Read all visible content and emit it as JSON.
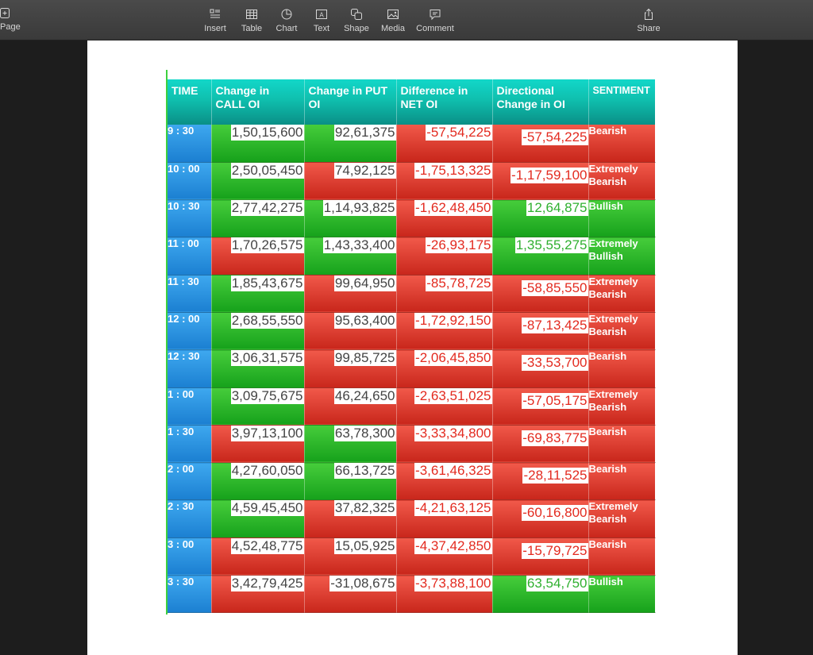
{
  "toolbar": {
    "page_label": "Page",
    "items": [
      {
        "label": "Insert",
        "icon": "insert-icon"
      },
      {
        "label": "Table",
        "icon": "table-icon"
      },
      {
        "label": "Chart",
        "icon": "chart-icon"
      },
      {
        "label": "Text",
        "icon": "text-icon"
      },
      {
        "label": "Shape",
        "icon": "shape-icon"
      },
      {
        "label": "Media",
        "icon": "media-icon"
      },
      {
        "label": "Comment",
        "icon": "comment-icon"
      }
    ],
    "share_label": "Share"
  },
  "table": {
    "headers": [
      "TIME",
      "Change in CALL OI",
      "Change in PUT OI",
      "Difference in NET OI",
      "Directional Change in OI",
      "SENTIMENT"
    ],
    "rows": [
      {
        "time": "9 : 30",
        "call": "1,50,15,600",
        "put": "92,61,375",
        "diff": "-57,54,225",
        "dir": "-57,54,225",
        "sentiment": "Bearish"
      },
      {
        "time": "10 : 00",
        "call": "2,50,05,450",
        "put": "74,92,125",
        "diff": "-1,75,13,325",
        "dir": "-1,17,59,100",
        "sentiment": "Extremely Bearish"
      },
      {
        "time": "10 : 30",
        "call": "2,77,42,275",
        "put": "1,14,93,825",
        "diff": "-1,62,48,450",
        "dir": "12,64,875",
        "sentiment": "Bullish"
      },
      {
        "time": "11 : 00",
        "call": "1,70,26,575",
        "put": "1,43,33,400",
        "diff": "-26,93,175",
        "dir": "1,35,55,275",
        "sentiment": "Extremely Bullish"
      },
      {
        "time": "11 : 30",
        "call": "1,85,43,675",
        "put": "99,64,950",
        "diff": "-85,78,725",
        "dir": "-58,85,550",
        "sentiment": "Extremely Bearish"
      },
      {
        "time": "12 : 00",
        "call": "2,68,55,550",
        "put": "95,63,400",
        "diff": "-1,72,92,150",
        "dir": "-87,13,425",
        "sentiment": "Extremely Bearish"
      },
      {
        "time": "12 : 30",
        "call": "3,06,31,575",
        "put": "99,85,725",
        "diff": "-2,06,45,850",
        "dir": "-33,53,700",
        "sentiment": "Bearish"
      },
      {
        "time": "1 : 00",
        "call": "3,09,75,675",
        "put": "46,24,650",
        "diff": "-2,63,51,025",
        "dir": "-57,05,175",
        "sentiment": "Extremely Bearish"
      },
      {
        "time": "1 : 30",
        "call": "3,97,13,100",
        "put": "63,78,300",
        "diff": "-3,33,34,800",
        "dir": "-69,83,775",
        "sentiment": "Bearish"
      },
      {
        "time": "2 : 00",
        "call": "4,27,60,050",
        "put": "66,13,725",
        "diff": "-3,61,46,325",
        "dir": "-28,11,525",
        "sentiment": "Bearish"
      },
      {
        "time": "2 : 30",
        "call": "4,59,45,450",
        "put": "37,82,325",
        "diff": "-4,21,63,125",
        "dir": "-60,16,800",
        "sentiment": "Extremely Bearish"
      },
      {
        "time": "3 : 00",
        "call": "4,52,48,775",
        "put": "15,05,925",
        "diff": "-4,37,42,850",
        "dir": "-15,79,725",
        "sentiment": "Bearish"
      },
      {
        "time": "3 : 30",
        "call": "3,42,79,425",
        "put": "-31,08,675",
        "diff": "-3,73,88,100",
        "dir": "63,54,750",
        "sentiment": "Bullish"
      }
    ]
  },
  "colors": {
    "header_teal": "#0fbfae",
    "time_blue": "#1b7fd1",
    "cell_green": "#16a11b",
    "cell_red": "#c8261b",
    "value_red": "#e32a1f",
    "value_green": "#2fb02f"
  },
  "cell_colors": [
    [
      "g",
      "g",
      "r",
      "r",
      "r"
    ],
    [
      "g",
      "r",
      "r",
      "r",
      "r"
    ],
    [
      "g",
      "g",
      "r",
      "g",
      "g"
    ],
    [
      "r",
      "g",
      "r",
      "g",
      "g"
    ],
    [
      "g",
      "r",
      "r",
      "r",
      "r"
    ],
    [
      "g",
      "r",
      "r",
      "r",
      "r"
    ],
    [
      "g",
      "r",
      "r",
      "r",
      "r"
    ],
    [
      "g",
      "r",
      "r",
      "r",
      "r"
    ],
    [
      "r",
      "g",
      "r",
      "r",
      "r"
    ],
    [
      "g",
      "g",
      "r",
      "r",
      "r"
    ],
    [
      "g",
      "r",
      "r",
      "r",
      "r"
    ],
    [
      "r",
      "r",
      "r",
      "r",
      "r"
    ],
    [
      "r",
      "r",
      "r",
      "g",
      "g"
    ]
  ]
}
